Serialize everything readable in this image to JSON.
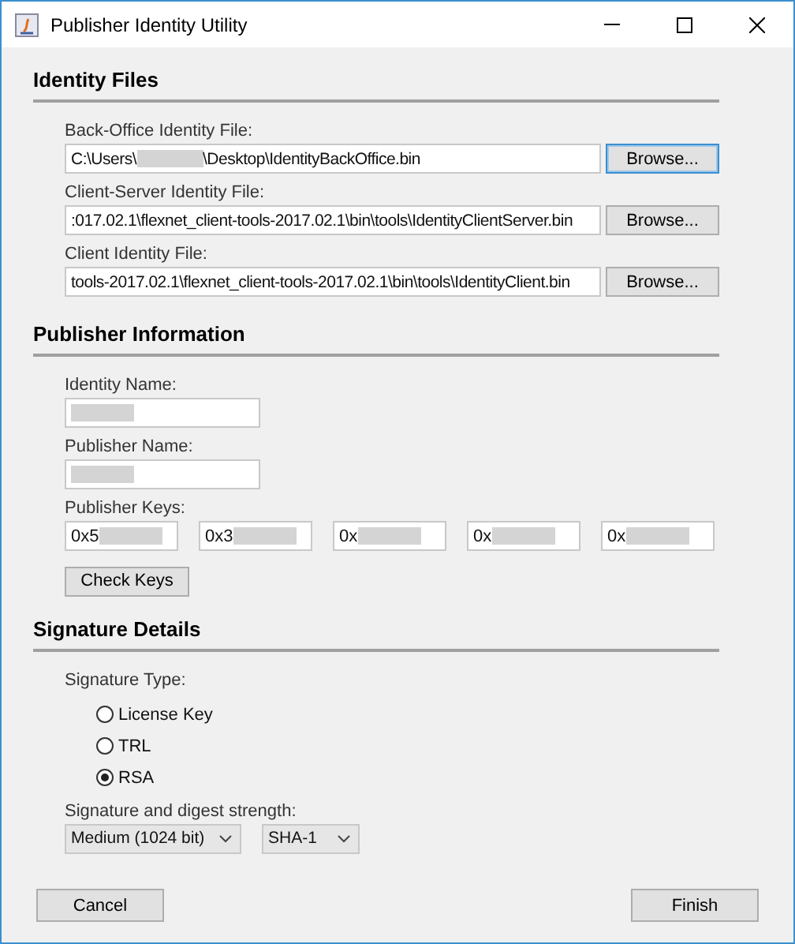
{
  "window": {
    "title": "Publisher Identity Utility"
  },
  "sections": [
    {
      "title": "Identity Files",
      "kind": "files",
      "fields": [
        {
          "label": "Back-Office Identity File:",
          "parts": [
            {
              "kind": "text",
              "text": "C:\\Users\\"
            },
            {
              "kind": "redacted"
            },
            {
              "kind": "text",
              "text": "\\Desktop\\IdentityBackOffice.bin"
            }
          ],
          "button": "Browse...",
          "focused": true
        },
        {
          "label": "Client-Server Identity File:",
          "parts": [
            {
              "kind": "text",
              "text": ":017.02.1\\flexnet_client-tools-2017.02.1\\bin\\tools\\IdentityClientServer.bin"
            }
          ],
          "button": "Browse...",
          "focused": false
        },
        {
          "label": "Client Identity File:",
          "parts": [
            {
              "kind": "text",
              "text": "tools-2017.02.1\\flexnet_client-tools-2017.02.1\\bin\\tools\\IdentityClient.bin"
            }
          ],
          "button": "Browse...",
          "focused": false
        }
      ]
    },
    {
      "title": "Publisher Information",
      "kind": "publisher",
      "fields": [
        {
          "label": "Identity Name:",
          "parts": [
            {
              "kind": "redacted"
            }
          ]
        },
        {
          "label": "Publisher Name:",
          "parts": [
            {
              "kind": "redacted"
            }
          ]
        }
      ],
      "keys_label": "Publisher Keys:",
      "keys": [
        {
          "parts": [
            {
              "kind": "text",
              "text": "0x5"
            },
            {
              "kind": "redacted"
            }
          ]
        },
        {
          "parts": [
            {
              "kind": "text",
              "text": "0x3"
            },
            {
              "kind": "redacted"
            }
          ]
        },
        {
          "parts": [
            {
              "kind": "text",
              "text": "0x"
            },
            {
              "kind": "redacted"
            }
          ]
        },
        {
          "parts": [
            {
              "kind": "text",
              "text": "0x"
            },
            {
              "kind": "redacted"
            }
          ]
        },
        {
          "parts": [
            {
              "kind": "text",
              "text": "0x"
            },
            {
              "kind": "redacted"
            }
          ]
        }
      ],
      "button": "Check Keys"
    },
    {
      "title": "Signature Details",
      "kind": "signature",
      "type_label": "Signature Type:",
      "options": [
        {
          "label": "License Key",
          "selected": false
        },
        {
          "label": "TRL",
          "selected": false
        },
        {
          "label": "RSA",
          "selected": true
        }
      ],
      "strength_label": "Signature and digest strength:",
      "selects": [
        "Medium (1024 bit)",
        "SHA-1"
      ]
    }
  ],
  "buttons": [
    {
      "label": "Cancel"
    },
    {
      "label": "Finish"
    }
  ]
}
